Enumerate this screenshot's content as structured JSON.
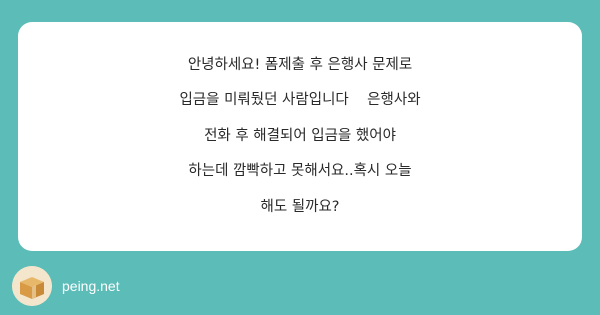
{
  "question": {
    "lines": [
      "안녕하세요! 폼제출 후 은행사 문제로",
      "입금을 미뤄뒀던 사람입니다    은행사와",
      "전화 후 해결되어 입금을 했어야",
      "하는데 깜빡하고 못해서요..혹시 오늘",
      "해도 될까요?"
    ]
  },
  "footer": {
    "logo_icon": "box-icon",
    "site_name": "peing.net"
  },
  "colors": {
    "background": "#5bbcb8",
    "card": "#ffffff",
    "text": "#2a2a2a"
  }
}
